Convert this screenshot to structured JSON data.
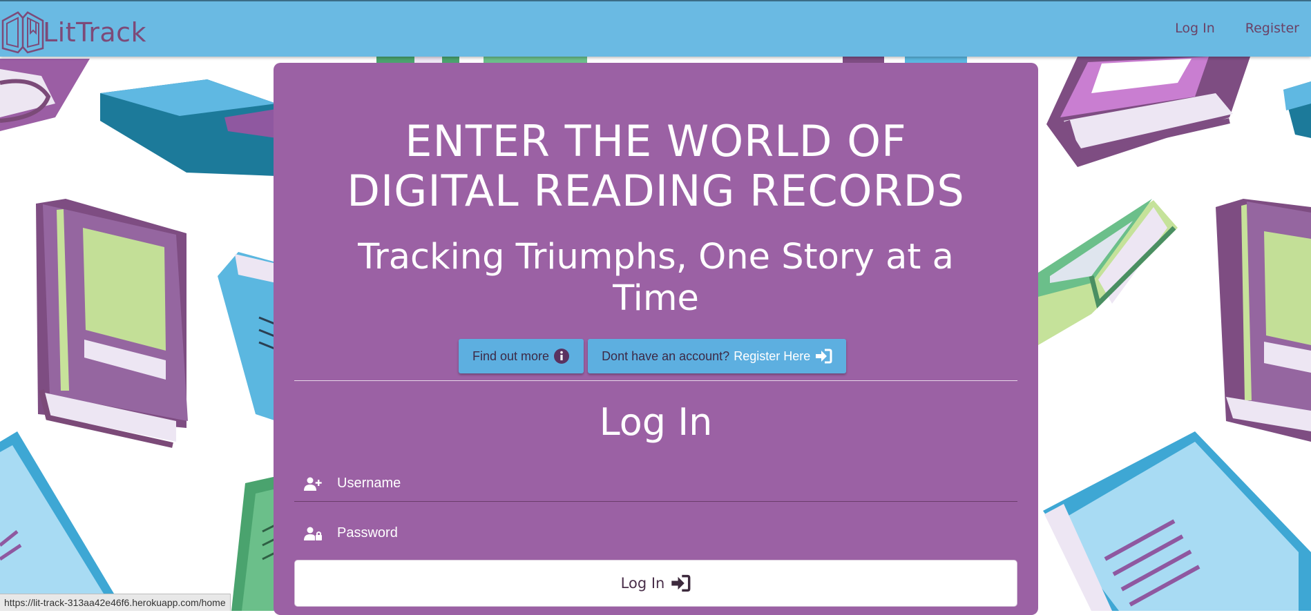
{
  "brand": {
    "name": "LitTrack",
    "logo_icon": "open-book-logo-icon"
  },
  "nav": {
    "login": "Log In",
    "register": "Register"
  },
  "hero": {
    "headline_line1": "ENTER THE WORLD OF",
    "headline_line2": "DIGITAL READING RECORDS",
    "tagline_line1": "Tracking Triumphs, One Story at a",
    "tagline_line2": "Time"
  },
  "cta": {
    "find_out_more": "Find out more",
    "find_out_more_icon": "info-circle-icon",
    "no_account_text": "Dont have an account?",
    "register_here": "Register Here",
    "register_icon": "sign-in-icon"
  },
  "login_form": {
    "title": "Log In",
    "username_placeholder": "Username",
    "password_placeholder": "Password",
    "username_icon": "user-plus-icon",
    "password_icon": "user-lock-icon",
    "submit_label": "Log In",
    "submit_icon": "sign-in-icon"
  },
  "status_bar": {
    "url": "https://lit-track-313aa42e46f6.herokuapp.com/home"
  },
  "colors": {
    "navbar": "#6abae3",
    "card": "#9b61a4",
    "brand_text": "#7d4a78",
    "cta_button": "#5dafe0"
  }
}
